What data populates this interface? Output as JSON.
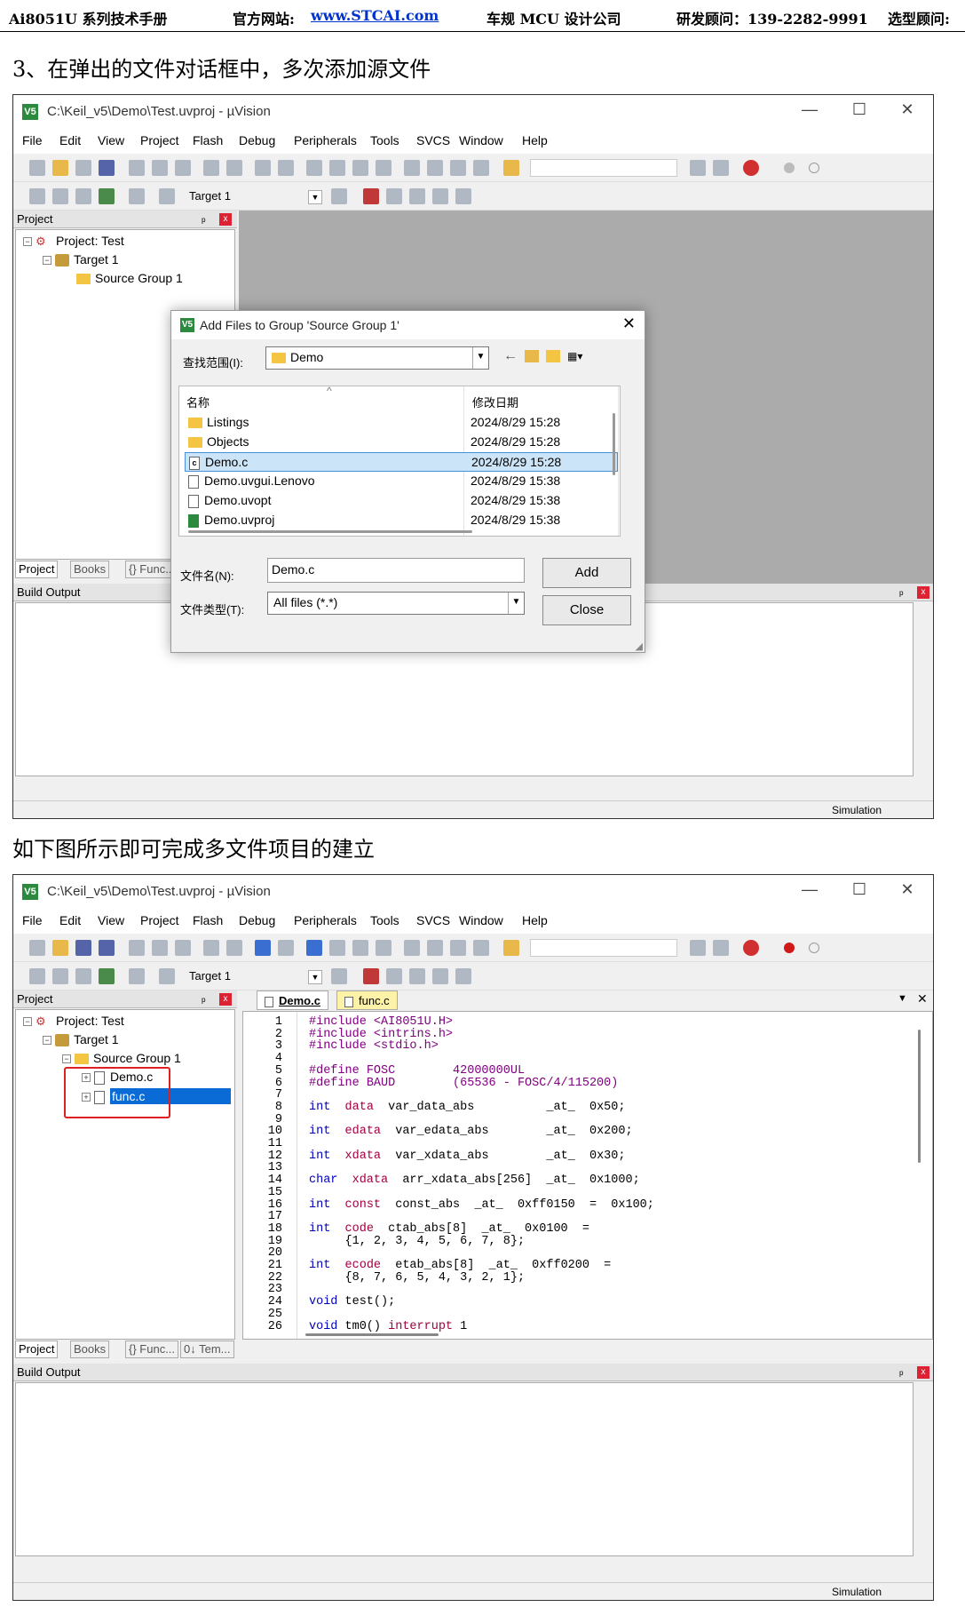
{
  "header": {
    "product": "Ai8051U 系列技术手册",
    "site_label": "官方网站: ",
    "site_link": "www.STCAI.com",
    "company": "车规 MCU 设计公司",
    "advisor": "研发顾问：139-2282-9991",
    "selector": "选型顾问:"
  },
  "step3_caption": "3、在弹出的文件对话框中，多次添加源文件",
  "final_caption": "如下图所示即可完成多文件项目的建立",
  "window": {
    "app_icon": "V5",
    "title": "C:\\Keil_v5\\Demo\\Test.uvproj - µVision",
    "minimize": "—",
    "maximize": "☐",
    "close": "✕",
    "menu": [
      "File",
      "Edit",
      "View",
      "Project",
      "Flash",
      "Debug",
      "Peripherals",
      "Tools",
      "SVCS",
      "Window",
      "Help"
    ],
    "target": "Target 1",
    "project_panel_title": "Project",
    "pin": "ᵖ",
    "panel_close": "x",
    "tree": {
      "project": "Project: Test",
      "target": "Target 1",
      "group": "Source Group 1"
    },
    "panel_tabs": [
      "Project",
      "Books",
      "{} Func...",
      "0↓ Tem..."
    ],
    "build_output": "Build Output",
    "status": "Simulation"
  },
  "dialog": {
    "title": "Add Files to Group 'Source Group 1'",
    "close": "✕",
    "lookin_label": "查找范围(I):",
    "lookin_value": "Demo",
    "col_name": "名称",
    "col_date": "修改日期",
    "files": [
      {
        "name": "Listings",
        "date": "2024/8/29 15:28",
        "kind": "folder"
      },
      {
        "name": "Objects",
        "date": "2024/8/29 15:28",
        "kind": "folder"
      },
      {
        "name": "Demo.c",
        "date": "2024/8/29 15:28",
        "kind": "c"
      },
      {
        "name": "Demo.uvgui.Lenovo",
        "date": "2024/8/29 15:38",
        "kind": "file"
      },
      {
        "name": "Demo.uvopt",
        "date": "2024/8/29 15:38",
        "kind": "file"
      },
      {
        "name": "Demo.uvproj",
        "date": "2024/8/29 15:38",
        "kind": "proj"
      }
    ],
    "filename_label": "文件名(N):",
    "filename_value": "Demo.c",
    "filetype_label": "文件类型(T):",
    "filetype_value": "All files (*.*)",
    "add": "Add",
    "close_btn": "Close"
  },
  "tree2": {
    "file1": "Demo.c",
    "file2": "func.c"
  },
  "editor": {
    "tab1": "Demo.c",
    "tab2": "func.c",
    "lines": [
      {
        "n": "1",
        "t": "#include <AI8051U.H>"
      },
      {
        "n": "2",
        "t": "#include <intrins.h>"
      },
      {
        "n": "3",
        "t": "#include <stdio.h>"
      },
      {
        "n": "4",
        "t": ""
      },
      {
        "n": "5",
        "t": "#define FOSC        42000000UL"
      },
      {
        "n": "6",
        "t": "#define BAUD        (65536 - FOSC/4/115200)"
      },
      {
        "n": "7",
        "t": ""
      },
      {
        "n": "8",
        "t": "int  data  var_data_abs          _at_  0x50;"
      },
      {
        "n": "9",
        "t": ""
      },
      {
        "n": "10",
        "t": "int  edata  var_edata_abs        _at_  0x200;"
      },
      {
        "n": "11",
        "t": ""
      },
      {
        "n": "12",
        "t": "int  xdata  var_xdata_abs        _at_  0x30;"
      },
      {
        "n": "13",
        "t": ""
      },
      {
        "n": "14",
        "t": "char  xdata  arr_xdata_abs[256]  _at_  0x1000;"
      },
      {
        "n": "15",
        "t": ""
      },
      {
        "n": "16",
        "t": "int  const  const_abs  _at_  0xff0150  =  0x100;"
      },
      {
        "n": "17",
        "t": ""
      },
      {
        "n": "18",
        "t": "int  code  ctab_abs[8]  _at_  0x0100  ="
      },
      {
        "n": "19",
        "t": "     {1, 2, 3, 4, 5, 6, 7, 8};"
      },
      {
        "n": "20",
        "t": ""
      },
      {
        "n": "21",
        "t": "int  ecode  etab_abs[8]  _at_  0xff0200  ="
      },
      {
        "n": "22",
        "t": "     {8, 7, 6, 5, 4, 3, 2, 1};"
      },
      {
        "n": "23",
        "t": ""
      },
      {
        "n": "24",
        "t": "void test();"
      },
      {
        "n": "25",
        "t": ""
      },
      {
        "n": "26",
        "t": "void tm0() interrupt 1"
      }
    ]
  }
}
